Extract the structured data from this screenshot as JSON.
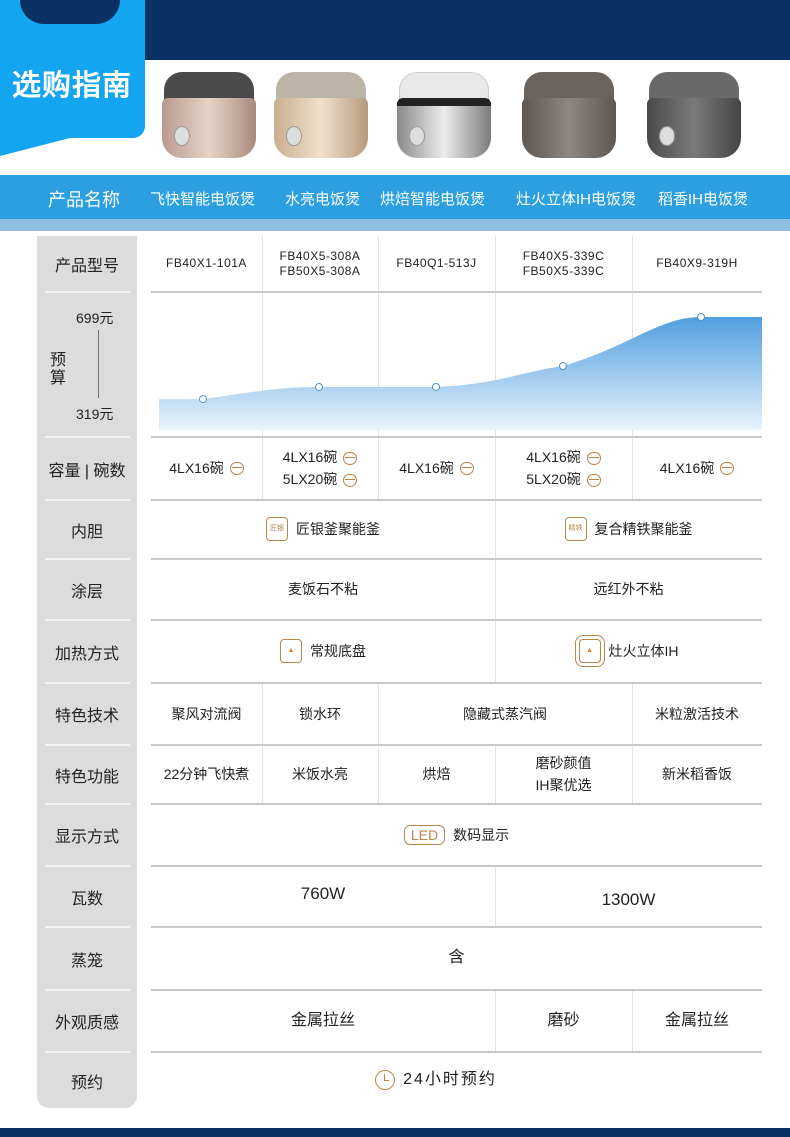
{
  "header": {
    "title": "选购指南"
  },
  "names_row": {
    "label": "产品名称",
    "products": [
      "飞快智能电饭煲",
      "水亮电饭煲",
      "烘焙智能电饭煲",
      "灶火立体IH电饭煲",
      "稻香IH电饭煲"
    ]
  },
  "rows": {
    "model": {
      "label": "产品型号",
      "values": [
        [
          "FB40X1-101A"
        ],
        [
          "FB40X5-308A",
          "FB50X5-308A"
        ],
        [
          "FB40Q1-513J"
        ],
        [
          "FB40X5-339C",
          "FB50X5-339C"
        ],
        [
          "FB40X9-319H"
        ]
      ]
    },
    "budget": {
      "label_1": "预",
      "label_2": "算",
      "max_label": "699元",
      "min_label": "319元"
    },
    "capacity": {
      "label": "容量 | 碗数",
      "values": [
        [
          "4LX16碗"
        ],
        [
          "4LX16碗",
          "5LX20碗"
        ],
        [
          "4LX16碗"
        ],
        [
          "4LX16碗",
          "5LX20碗"
        ],
        [
          "4LX16碗"
        ]
      ]
    },
    "inner_pot": {
      "label": "内胆",
      "a": "匠银釜聚能釜",
      "a_badge": "匠银",
      "b": "复合精铁聚能釜",
      "b_badge": "精铁"
    },
    "coating": {
      "label": "涂层",
      "a": "麦饭石不粘",
      "b": "远红外不粘"
    },
    "heating": {
      "label": "加热方式",
      "a": "常规底盘",
      "b": "灶火立体IH"
    },
    "tech": {
      "label": "特色技术",
      "values": [
        "聚风对流阀",
        "锁水环",
        "隐藏式蒸汽阀",
        "米粒激活技术"
      ]
    },
    "features": {
      "label": "特色功能",
      "values": [
        "22分钟飞快煮",
        "米饭水亮",
        "烘焙",
        "磨砂颜值",
        "IH聚优选",
        "新米稻香饭"
      ]
    },
    "display": {
      "label": "显示方式",
      "badge": "LED",
      "value": "数码显示"
    },
    "wattage": {
      "label": "瓦数",
      "a": "760W",
      "b": "1300W"
    },
    "steamer": {
      "label": "蒸笼",
      "value": "含"
    },
    "finish": {
      "label": "外观质感",
      "a": "金属拉丝",
      "b": "磨砂",
      "c": "金属拉丝"
    },
    "schedule": {
      "label": "预约",
      "value": "24小时预约"
    }
  },
  "chart_data": {
    "type": "area",
    "categories": [
      "飞快智能电饭煲",
      "水亮电饭煲",
      "烘焙智能电饭煲",
      "灶火立体IH电饭煲",
      "稻香IH电饭煲"
    ],
    "values": [
      374,
      422,
      422,
      505,
      699
    ],
    "ylim": [
      319,
      699
    ],
    "ylabel": "预算",
    "color": "#5aa6e0"
  },
  "colors": {
    "navy": "#0a3163",
    "blue": "#2b9fe0",
    "gold": "#b8864a"
  }
}
